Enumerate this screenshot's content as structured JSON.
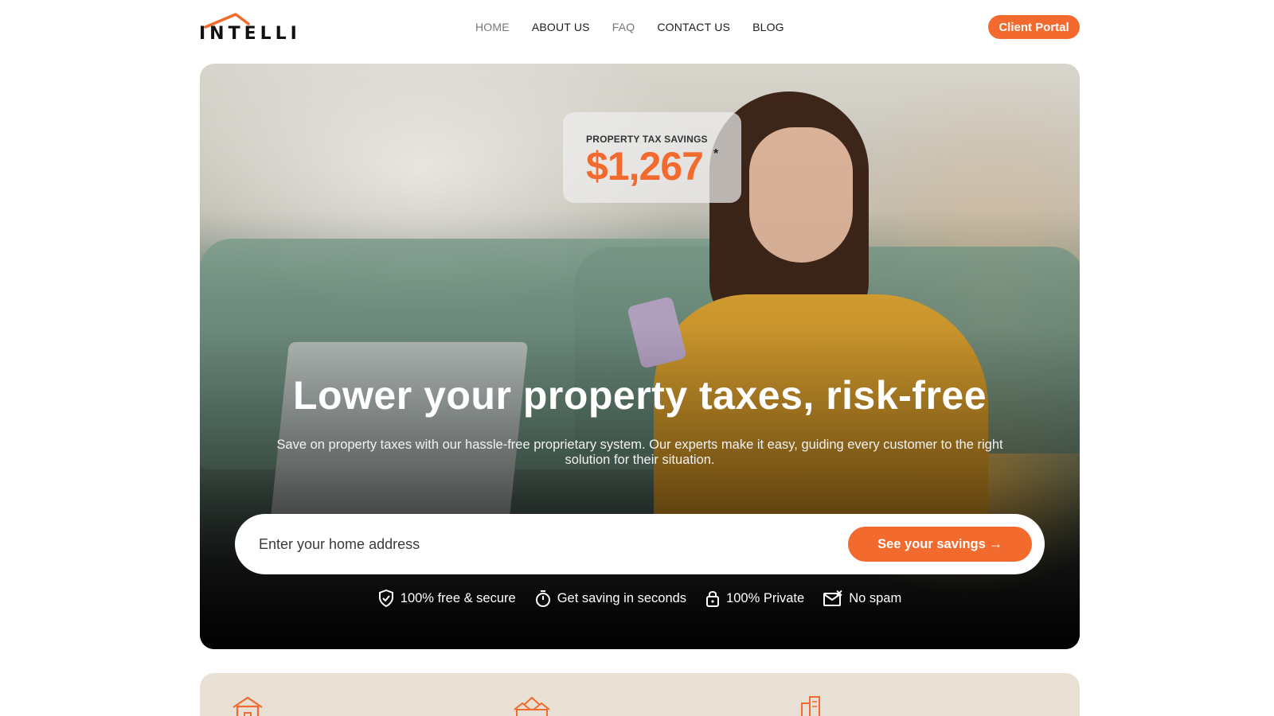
{
  "header": {
    "logo_text": "INTELLI",
    "nav": [
      {
        "label": "HOME"
      },
      {
        "label": "ABOUT US"
      },
      {
        "label": "FAQ"
      },
      {
        "label": "CONTACT US"
      },
      {
        "label": "BLOG"
      }
    ],
    "portal_button": "Client Portal"
  },
  "hero": {
    "savings_card": {
      "label": "PROPERTY TAX SAVINGS",
      "amount": "$1,267",
      "footnote": "*"
    },
    "title": "Lower your property taxes, risk-free",
    "subtitle": "Save on property taxes with our hassle-free proprietary system. Our experts make it easy, guiding every customer to the right solution for their situation.",
    "search": {
      "placeholder": "Enter your home address",
      "value": "",
      "cta_label": "See your savings →"
    },
    "badges": [
      {
        "label": "100% free & secure",
        "icon": "shield-check-icon"
      },
      {
        "label": "Get saving in seconds",
        "icon": "stopwatch-icon"
      },
      {
        "label": "100% Private",
        "icon": "lock-icon"
      },
      {
        "label": "No spam",
        "icon": "mail-x-icon"
      }
    ]
  },
  "features": {
    "icons": [
      "house-icon",
      "neighborhood-icon",
      "building-icon"
    ]
  },
  "colors": {
    "accent": "#f26a2e",
    "features_bg": "#e8e0d5",
    "text_dark": "#1c1c1c"
  }
}
